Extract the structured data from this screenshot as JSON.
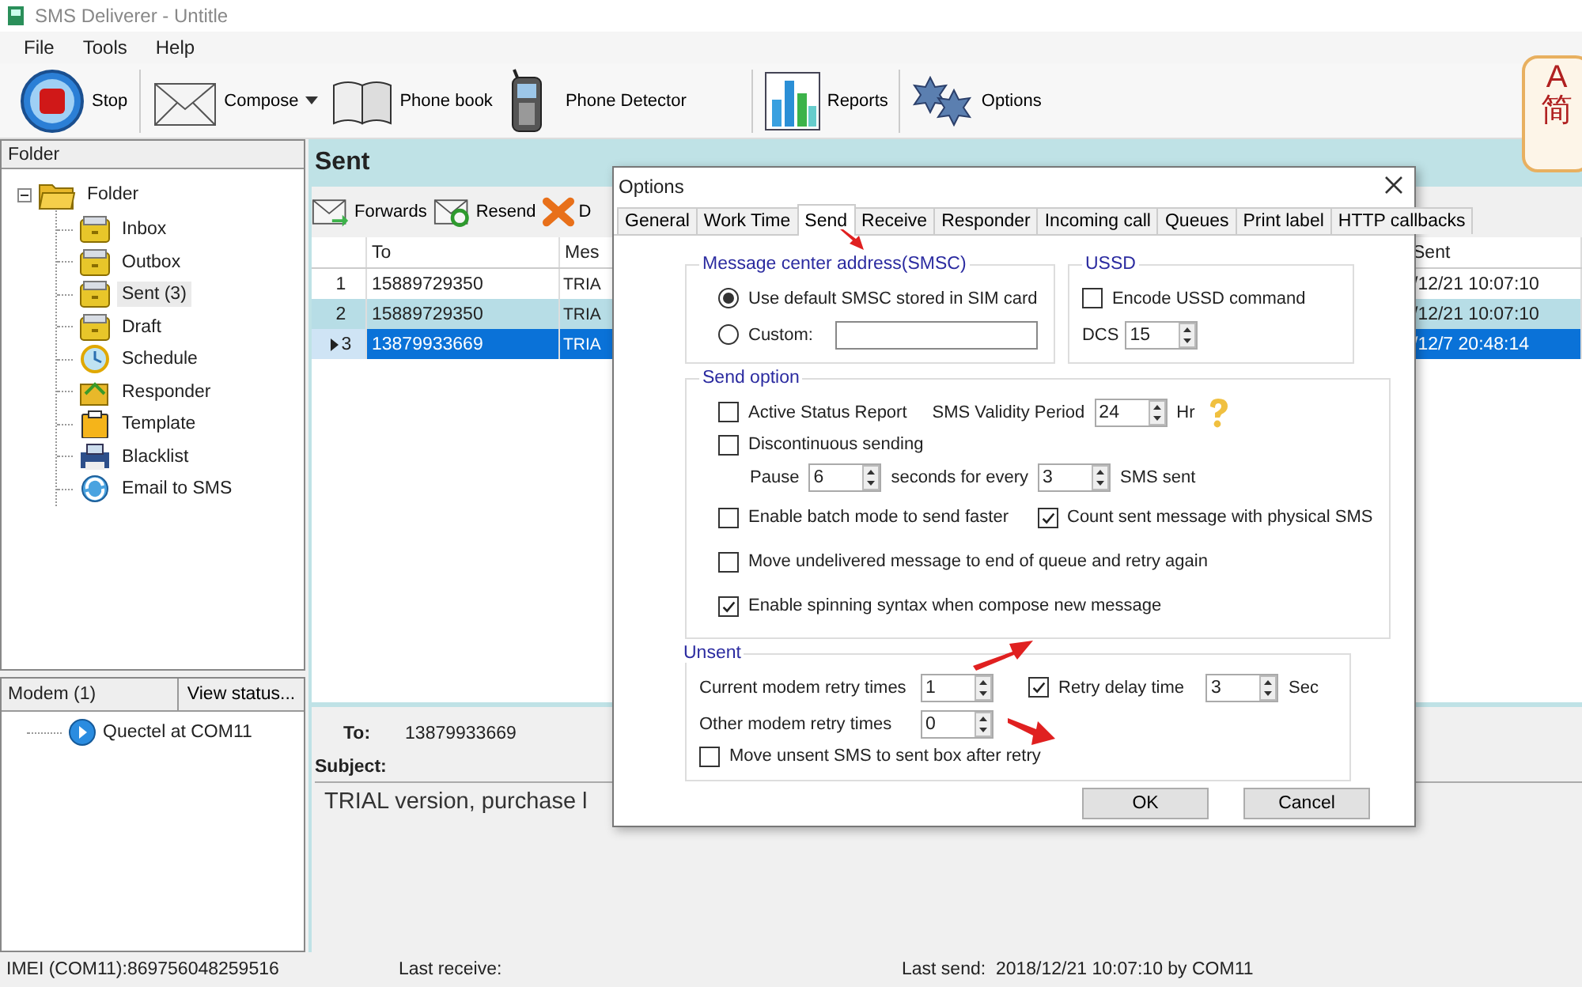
{
  "window": {
    "title": "SMS Deliverer - Untitle"
  },
  "menu": [
    "File",
    "Tools",
    "Help"
  ],
  "toolbar": [
    {
      "label": "Stop",
      "kind": "stop",
      "has_menu": false
    },
    {
      "label": "Compose",
      "kind": "compose",
      "has_menu": true
    },
    {
      "label": "Phone book",
      "kind": "book",
      "has_menu": false
    },
    {
      "label": "Phone Detector",
      "kind": "phone",
      "has_menu": false
    },
    {
      "label": "Reports",
      "kind": "reports",
      "has_menu": false
    },
    {
      "label": "Options",
      "kind": "options",
      "has_menu": false
    }
  ],
  "ime": [
    "A",
    "简"
  ],
  "folder_panel": {
    "header": "Folder",
    "tree": {
      "label": "Folder",
      "expanded": true,
      "children": [
        {
          "label": "Inbox",
          "kind": "box",
          "selected": false
        },
        {
          "label": "Outbox",
          "kind": "box",
          "selected": false
        },
        {
          "label": "Sent (3)",
          "kind": "box",
          "selected": true
        },
        {
          "label": "Draft",
          "kind": "box",
          "selected": false
        },
        {
          "label": "Schedule",
          "kind": "schedule",
          "selected": false
        },
        {
          "label": "Responder",
          "kind": "responder",
          "selected": false
        },
        {
          "label": "Template",
          "kind": "template",
          "selected": false
        },
        {
          "label": "Blacklist",
          "kind": "blacklist",
          "selected": false
        },
        {
          "label": "Email to SMS",
          "kind": "email",
          "selected": false
        }
      ]
    }
  },
  "modem_panel": {
    "header": "Modem (1)",
    "button": "View status...",
    "items": [
      "Quectel at COM11"
    ]
  },
  "sent_view": {
    "title": "Sent",
    "actions": [
      {
        "label": "Forwards",
        "kind": "forward"
      },
      {
        "label": "Resend",
        "kind": "resend"
      },
      {
        "label": "D",
        "kind": "delete"
      }
    ],
    "table": {
      "columns": [
        "To",
        "Mes",
        "Sent"
      ],
      "rows": [
        {
          "number": "1",
          "to": "15889729350",
          "message": "TRIA",
          "sent": "/12/21 10:07:10",
          "selected": false
        },
        {
          "number": "2",
          "to": "15889729350",
          "message": "TRIA",
          "sent": "/12/21 10:07:10",
          "selected": false
        },
        {
          "number": "3",
          "to": "13879933669",
          "message": "TRIA",
          "sent": "/12/7 20:48:14",
          "selected": true
        }
      ]
    },
    "preview": {
      "to_label": "To:",
      "to": "13879933669",
      "subject_label": "Subject:",
      "body": "TRIAL version, purchase l"
    }
  },
  "status_bar": {
    "imei": "IMEI (COM11):869756048259516",
    "last_receive": "Last receive:",
    "last_send": "Last send:  2018/12/21 10:07:10 by COM11"
  },
  "dialog": {
    "title": "Options",
    "tabs": [
      {
        "label": "General",
        "selected": false
      },
      {
        "label": "Work Time",
        "selected": false
      },
      {
        "label": "Send",
        "selected": true
      },
      {
        "label": "Receive",
        "selected": false
      },
      {
        "label": "Responder",
        "selected": false
      },
      {
        "label": "Incoming call",
        "selected": false
      },
      {
        "label": "Queues",
        "selected": false
      },
      {
        "label": "Print label",
        "selected": false
      },
      {
        "label": "HTTP callbacks",
        "selected": false
      }
    ],
    "smsc": {
      "title": "Message center address(SMSC)",
      "options": [
        {
          "label": "Use default SMSC stored in SIM card",
          "selected": true
        },
        {
          "label": "Custom:",
          "selected": false
        }
      ]
    },
    "ussd": {
      "title": "USSD",
      "encode": {
        "label": "Encode USSD command",
        "checked": false
      },
      "dcs_label": "DCS",
      "dcs": "15"
    },
    "send_option": {
      "title": "Send option",
      "status_report": {
        "label": "Active Status Report",
        "checked": false
      },
      "validity_label": "SMS Validity Period",
      "validity": "24",
      "validity_unit": "Hr",
      "discontinuous": {
        "label": "Discontinuous sending",
        "checked": false
      },
      "pause_label": "Pause",
      "pause": "6",
      "every_label": "seconds for every",
      "every": "3",
      "every_unit": "SMS sent",
      "batch": {
        "label": "Enable batch mode to send faster",
        "checked": false
      },
      "count_physical": {
        "label": "Count sent message with physical SMS",
        "checked": true
      },
      "move_undelivered": {
        "label": "Move undelivered message to end of queue and retry again",
        "checked": false
      },
      "spinning": {
        "label": "Enable spinning syntax when compose new message",
        "checked": true
      }
    },
    "unsent": {
      "title": "Unsent",
      "current_label": "Current modem retry times",
      "current": "1",
      "retry_delay": {
        "label": "Retry delay time",
        "checked": true
      },
      "delay": "3",
      "delay_unit": "Sec",
      "other_label": "Other modem retry times",
      "other": "0",
      "move_unsent": {
        "label": "Move unsent SMS to sent box after retry",
        "checked": false
      }
    },
    "buttons": [
      "OK",
      "Cancel"
    ]
  }
}
